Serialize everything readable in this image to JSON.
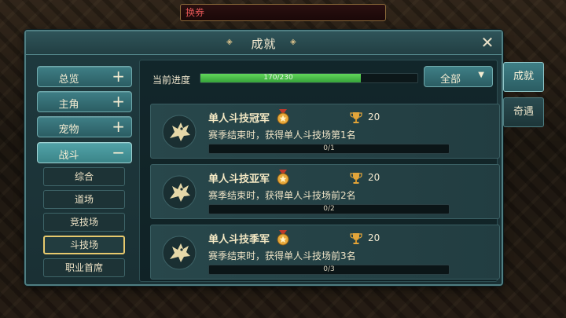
{
  "top_bar": {
    "text": "换券"
  },
  "panel": {
    "title": "成就"
  },
  "sidebar": {
    "categories": [
      {
        "label": "总览",
        "sign": "+"
      },
      {
        "label": "主角",
        "sign": "+"
      },
      {
        "label": "宠物",
        "sign": "+"
      },
      {
        "label": "战斗",
        "sign": "−"
      }
    ],
    "subitems": [
      {
        "label": "综合"
      },
      {
        "label": "道场"
      },
      {
        "label": "竞技场"
      },
      {
        "label": "斗技场"
      },
      {
        "label": "职业首席"
      }
    ]
  },
  "progress": {
    "label": "当前进度",
    "text": "170/230",
    "current": 170,
    "total": 230
  },
  "filter": {
    "value": "全部"
  },
  "achievements": [
    {
      "title": "单人斗技冠军",
      "reward": "20",
      "desc": "赛季结束时，获得单人斗技场第1名",
      "progress": "0/1"
    },
    {
      "title": "单人斗技亚军",
      "reward": "20",
      "desc": "赛季结束时，获得单人斗技场前2名",
      "progress": "0/2"
    },
    {
      "title": "单人斗技季军",
      "reward": "20",
      "desc": "赛季结束时，获得单人斗技场前3名",
      "progress": "0/3"
    }
  ],
  "side_tabs": [
    {
      "label": "成就"
    },
    {
      "label": "奇遇"
    }
  ],
  "icons": {
    "close": "close-icon",
    "dropdown": "chevron-down-icon",
    "achievement": "dragon-emblem-icon",
    "medal": "medal-icon",
    "reward": "trophy-icon"
  },
  "colors": {
    "accent": "#3f7f86",
    "progress_fill": "#4fc44a",
    "selected_border": "#e7c96d",
    "top_bar_text": "#e25555"
  }
}
